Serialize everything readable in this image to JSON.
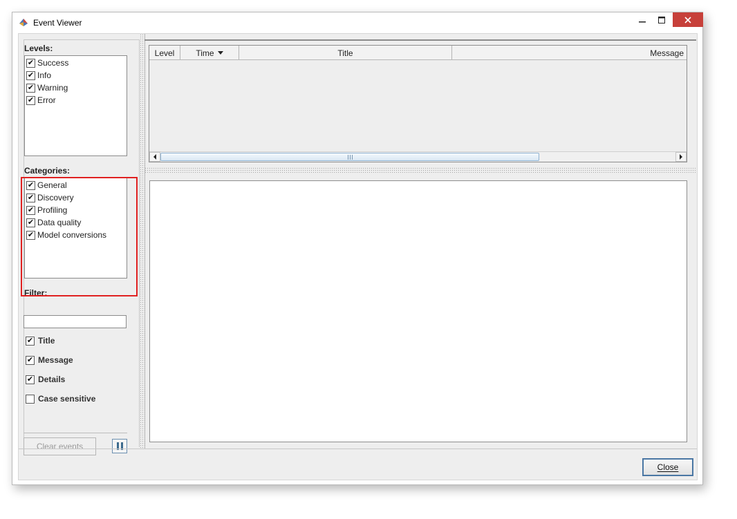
{
  "window": {
    "title": "Event Viewer",
    "buttons": {
      "minimize": "—",
      "maximize": "☐",
      "close": "✕"
    }
  },
  "left_panel": {
    "levels": {
      "label": "Levels:",
      "items": [
        {
          "label": "Success",
          "checked": true
        },
        {
          "label": "Info",
          "checked": true
        },
        {
          "label": "Warning",
          "checked": true
        },
        {
          "label": "Error",
          "checked": true
        }
      ]
    },
    "categories": {
      "label": "Categories:",
      "items": [
        {
          "label": "General",
          "checked": true
        },
        {
          "label": "Discovery",
          "checked": true
        },
        {
          "label": "Profiling",
          "checked": true
        },
        {
          "label": "Data quality",
          "checked": true
        },
        {
          "label": "Model conversions",
          "checked": true
        }
      ]
    },
    "filter": {
      "label": "Filter:",
      "value": "",
      "options": [
        {
          "label": "Title",
          "checked": true
        },
        {
          "label": "Message",
          "checked": true
        },
        {
          "label": "Details",
          "checked": true
        },
        {
          "label": "Case sensitive",
          "checked": false
        }
      ]
    },
    "clear_button": "Clear events",
    "check_glyph": "✔"
  },
  "events_table": {
    "columns": [
      "Level",
      "Time",
      "Title",
      "Message"
    ],
    "sort_column": "Time",
    "sort_direction": "descending",
    "rows": []
  },
  "footer": {
    "close_button": "Close"
  },
  "colors": {
    "highlight_border": "#e02020",
    "close_button_border": "#4a77a4",
    "titlebar_close_bg": "#c7403a"
  }
}
